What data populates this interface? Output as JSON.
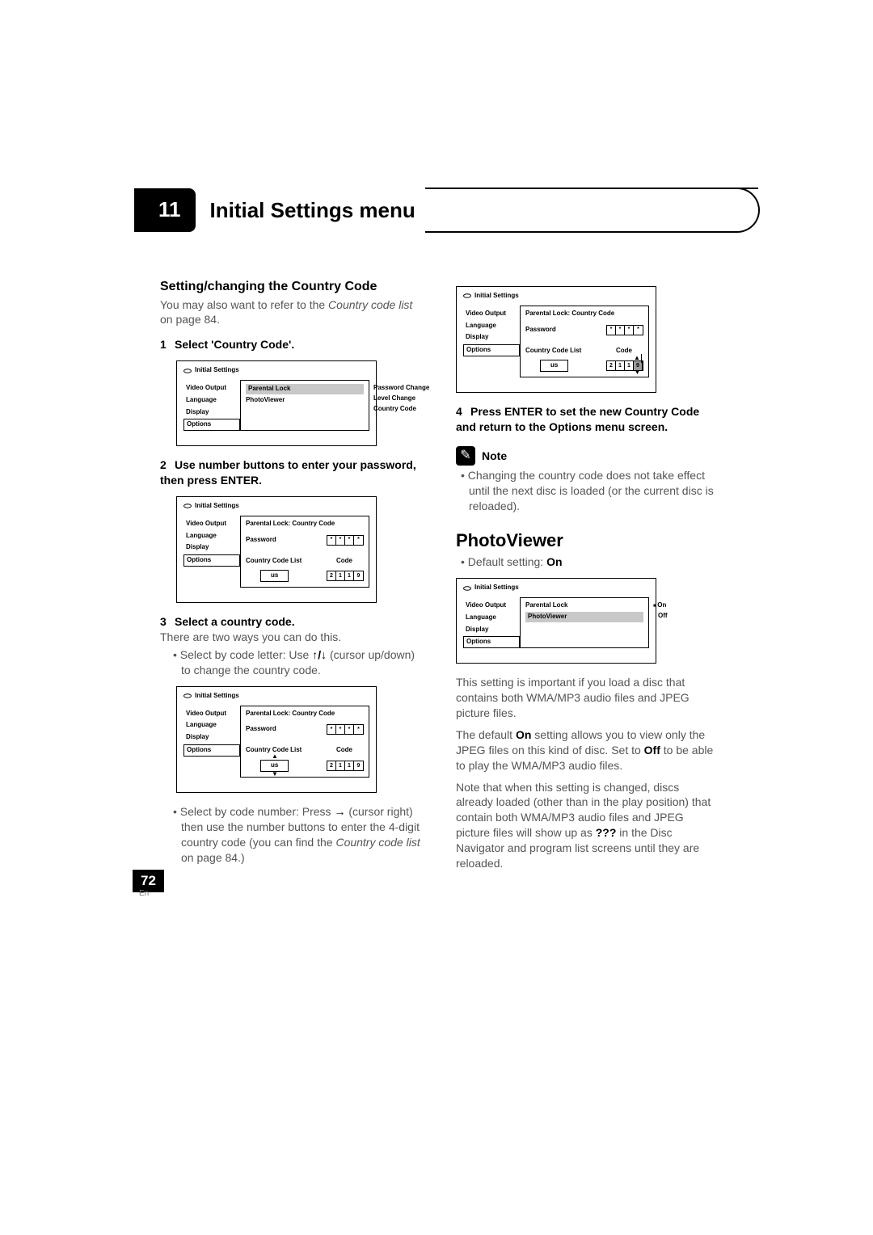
{
  "chapter": {
    "number": "11",
    "title": "Initial Settings menu"
  },
  "page": {
    "number": "72",
    "locale": "En"
  },
  "left": {
    "heading": "Setting/changing the Country Code",
    "intro1": "You may also want to refer to the ",
    "intro_it": "Country code list",
    "intro2": " on page 84.",
    "step1": "Select 'Country Code'.",
    "step2": "Use number buttons to enter your password, then press ENTER.",
    "step3": "Select a country code.",
    "step3_sub": "There are two ways you can do this.",
    "bullet_a1": "Select by code letter: Use ",
    "bullet_a2": " (cursor up/down) to change the country code.",
    "bullet_b1": "Select by code number: Press ",
    "bullet_b2": "(cursor right) then use the number buttons to enter the 4-digit country code (you can find the ",
    "bullet_b_it": "Country code list",
    "bullet_b3": " on page 84.)"
  },
  "right": {
    "step4": "Press ENTER to set the new Country Code and return to the Options menu screen.",
    "note_label": "Note",
    "note_bullet": "Changing the country code does not take effect until the next disc is loaded (or the current disc is reloaded).",
    "pv_heading": "PhotoViewer",
    "pv_default_pre": "Default setting: ",
    "pv_default_val": "On",
    "p1a": "This setting is important if you load a disc that contains both WMA/MP3 audio files and JPEG picture files.",
    "p2a": "The default ",
    "p2b": "On",
    "p2c": " setting allows you to view only the JPEG files on this kind of disc. Set to ",
    "p2d": "Off",
    "p2e": " to be able to play the WMA/MP3 audio files.",
    "p3a": "Note that when this setting is changed, discs already loaded (other than in the play position) that contain both WMA/MP3 audio files and JPEG picture files will show up as ",
    "p3b": "???",
    "p3c": " in the Disc Navigator and program list screens until they are reloaded."
  },
  "osd": {
    "title": "Initial Settings",
    "side": [
      "Video Output",
      "Language",
      "Display",
      "Options"
    ],
    "menu1_main": [
      "Parental Lock",
      "PhotoViewer"
    ],
    "menu1_right": [
      "Password Change",
      "Level Change",
      "Country Code"
    ],
    "banner": "Parental Lock: Country Code",
    "password_label": "Password",
    "cclist_label": "Country Code List",
    "code_label": "Code",
    "us": "us",
    "digits_masked": [
      "*",
      "*",
      "*",
      "*"
    ],
    "digits_code": [
      "2",
      "1",
      "1",
      "9"
    ],
    "pv_main": [
      "Parental Lock",
      "PhotoViewer"
    ],
    "pv_right": [
      "On",
      "Off"
    ]
  }
}
